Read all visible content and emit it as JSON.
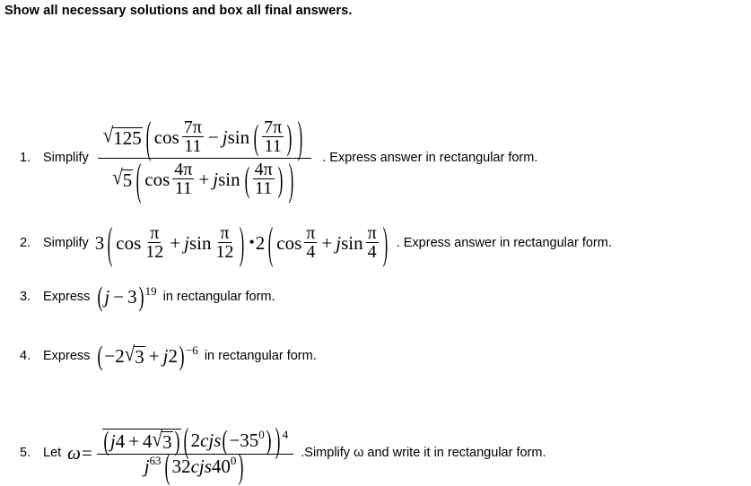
{
  "instruction": "Show all necessary solutions and box all final answers.",
  "problems": [
    {
      "number": "1.",
      "verb": "Simplify",
      "tail": ". Express answer in rectangular form.",
      "expression_text": "sqrt(125)(cos 7π/11 - j sin(7π/11)) / (sqrt(5)(cos 4π/11 + j sin(4π/11)))",
      "numerator": {
        "coefficient_radicand": "125",
        "cos_label": "cos",
        "sin_label": "sin",
        "imaginary_unit": "j",
        "operator": "−",
        "angle_num": "7π",
        "angle_den": "11"
      },
      "denominator": {
        "coefficient_radicand": "5",
        "cos_label": "cos",
        "sin_label": "sin",
        "imaginary_unit": "j",
        "operator": "+",
        "angle_num": "4π",
        "angle_den": "11"
      }
    },
    {
      "number": "2.",
      "verb": "Simplify",
      "tail": ". Express answer in rectangular form.",
      "expression_text": "3(cos π/12 + j sin π/12)•2(cos π/4 + j sin π/4)",
      "factor1": {
        "coefficient": "3",
        "cos_label": "cos",
        "sin_label": "sin",
        "imaginary_unit": "j",
        "operator": "+",
        "angle_num": "π",
        "angle_den": "12"
      },
      "mult_symbol": "•",
      "factor2": {
        "coefficient": "2",
        "cos_label": "cos",
        "sin_label": "sin",
        "imaginary_unit": "j",
        "operator": "+",
        "angle_num": "π",
        "angle_den": "4"
      }
    },
    {
      "number": "3.",
      "verb": "Express",
      "tail": "in rectangular form.",
      "expression_text": "(j - 3)^19",
      "base_imaginary": "j",
      "base_operator": "−",
      "base_real": "3",
      "exponent": "19"
    },
    {
      "number": "4.",
      "verb": "Express",
      "tail": "in rectangular form.",
      "expression_text": "(-2sqrt(3) + j2)^-6",
      "real_sign": "−",
      "real_coefficient": "2",
      "real_radicand": "3",
      "operator": "+",
      "imaginary_unit": "j",
      "imaginary_coefficient": "2",
      "exponent": "−6"
    },
    {
      "number": "5.",
      "verb": "Let",
      "omega": "ω",
      "equals": "=",
      "tail": ".Simplify ω and write it in rectangular form.",
      "expression_text": "conj(j4 + 4sqrt(3))(2cjs(-35°))^4 / (j^63 (32cjs40°))",
      "numerator": {
        "conj_imaginary_unit": "j",
        "conj_imaginary_coefficient": "4",
        "conj_operator": "+",
        "conj_real_coefficient": "4",
        "conj_real_radicand": "3",
        "factor_coefficient": "2",
        "cjs_label": "cjs",
        "angle": "−35",
        "degree_symbol": "0",
        "exponent": "4"
      },
      "denominator": {
        "imaginary_unit": "j",
        "imaginary_exponent": "63",
        "coefficient": "32",
        "cjs_label": "cjs",
        "angle": "40",
        "degree_symbol": "0"
      }
    }
  ]
}
